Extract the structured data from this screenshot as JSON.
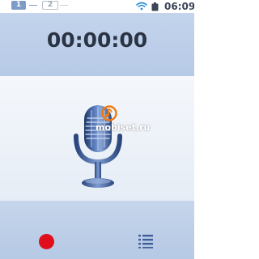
{
  "status_bar": {
    "sim1_label": "1",
    "sim2_label": "2",
    "time": "06:09",
    "icons": [
      "sim-1-icon",
      "sim-2-icon",
      "wifi-icon",
      "battery-icon"
    ]
  },
  "recorder": {
    "timer": "00:00:00",
    "center_icon": "microphone-icon",
    "record_icon": "record-icon",
    "list_icon": "list-icon"
  },
  "watermark": {
    "text": "mobiset.ru"
  },
  "colors": {
    "header_bg": "#bfd1eb",
    "mic_area_bg": "#eef3f9",
    "record_red": "#e10f1c",
    "accent_blue": "#3f5f99"
  }
}
